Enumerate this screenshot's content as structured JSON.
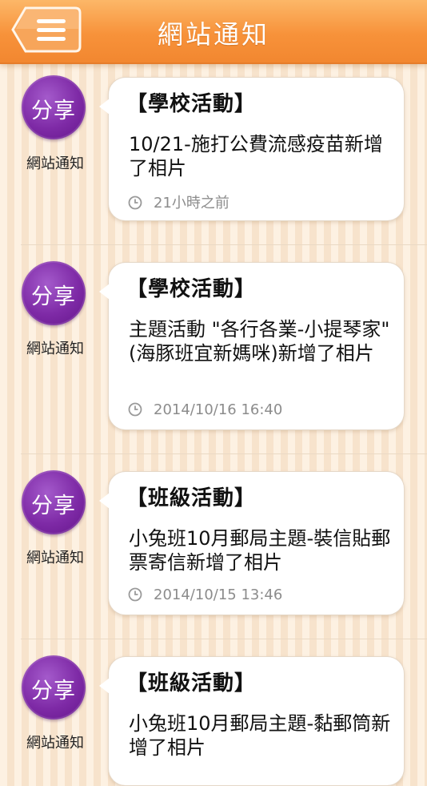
{
  "header": {
    "title": "網站通知",
    "menu_icon": "menu-icon"
  },
  "colors": {
    "header": "#f7923a",
    "badge": "#7e2aa6",
    "background": "#fdf1e2"
  },
  "feed": [
    {
      "badge_label": "分享",
      "source": "網站通知",
      "category": "【學校活動】",
      "text": "10/21-施打公費流感疫苗新增了相片",
      "time": "21小時之前"
    },
    {
      "badge_label": "分享",
      "source": "網站通知",
      "category": "【學校活動】",
      "text": "主題活動 \"各行各業-小提琴家\" (海豚班宜新媽咪)新增了相片",
      "time": "2014/10/16  16:40"
    },
    {
      "badge_label": "分享",
      "source": "網站通知",
      "category": "【班級活動】",
      "text": "小兔班10月郵局主題-裝信貼郵票寄信新增了相片",
      "time": "2014/10/15  13:46"
    },
    {
      "badge_label": "分享",
      "source": "網站通知",
      "category": "【班級活動】",
      "text": "小兔班10月郵局主題-黏郵筒新增了相片",
      "time": ""
    }
  ]
}
